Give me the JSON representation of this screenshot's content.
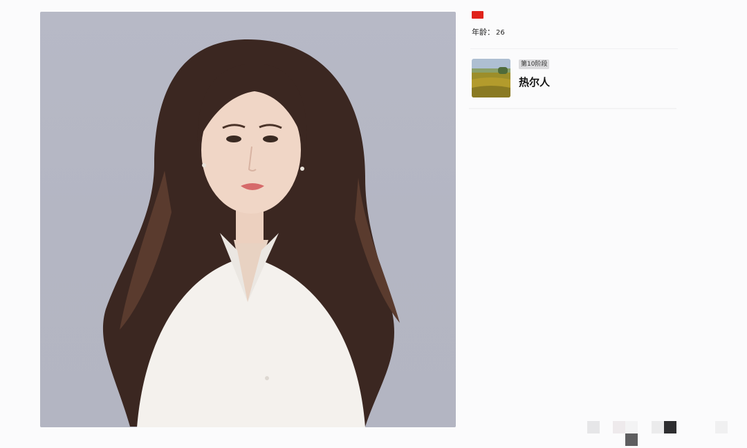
{
  "profile": {
    "flag_icon": "china-flag-icon",
    "age_label": "年龄：",
    "age_value": "26"
  },
  "stage": {
    "thumbnail_icon": "landscape-thumbnail",
    "badge": "第10阶段",
    "title": "热尔人"
  },
  "colors": {
    "background": "#fbfbfc",
    "photo_background": "#b5b7c4",
    "flag_red": "#e0231b",
    "badge_bg": "#dcdcde"
  }
}
